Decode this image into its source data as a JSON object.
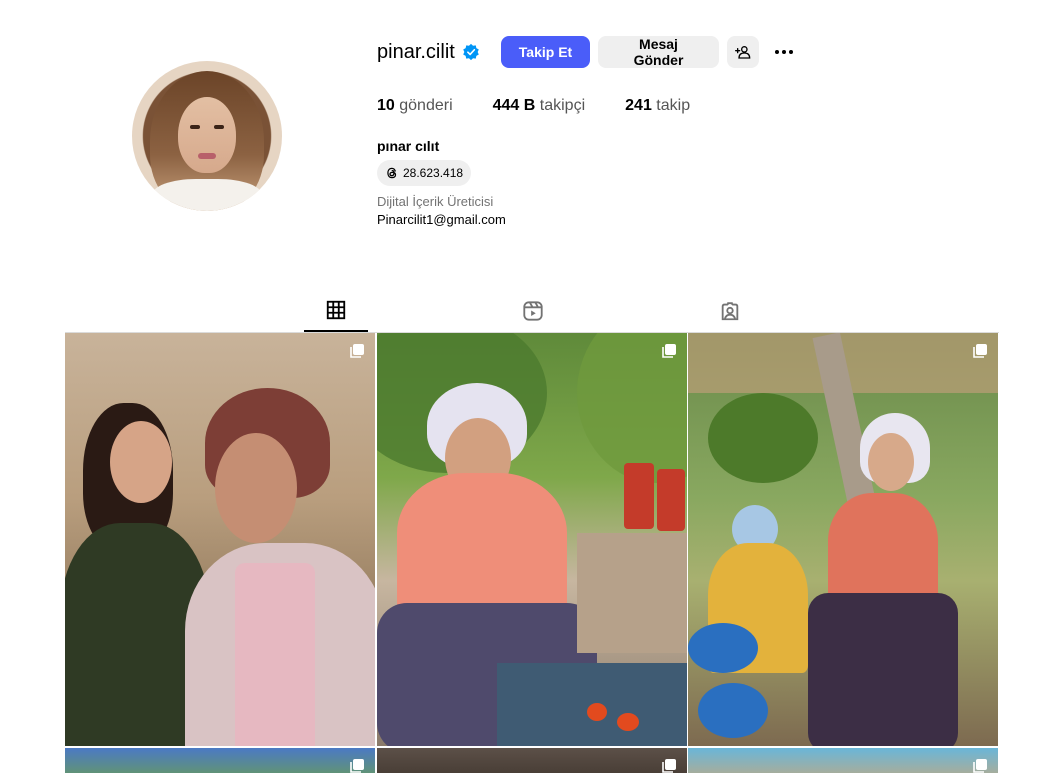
{
  "profile": {
    "username": "pinar.cilit",
    "verified": true,
    "follow_label": "Takip Et",
    "message_label": "Mesaj Gönder",
    "add_user_icon": "person-plus-icon",
    "more_icon": "more-horizontal-icon",
    "stats": {
      "posts_count": "10",
      "posts_label": "gönderi",
      "followers_count": "444 B",
      "followers_label": "takipçi",
      "following_count": "241",
      "following_label": "takip"
    },
    "full_name": "pınar cılıt",
    "threads_count": "28.623.418",
    "category": "Dijital İçerik Üreticisi",
    "email": "Pinarcilit1@gmail.com"
  },
  "tabs": [
    {
      "icon": "grid-icon",
      "active": true
    },
    {
      "icon": "reels-icon",
      "active": false
    },
    {
      "icon": "tagged-icon",
      "active": false
    }
  ],
  "posts": [
    {
      "icon": "multiple-images-icon"
    },
    {
      "icon": "multiple-images-icon"
    },
    {
      "icon": "multiple-images-icon"
    },
    {
      "icon": "multiple-images-icon"
    },
    {
      "icon": "multiple-images-icon"
    },
    {
      "icon": "multiple-images-icon"
    }
  ],
  "colors": {
    "follow_button": "#4a5df9",
    "secondary_button": "#efefef",
    "verified_badge": "#0095f6",
    "muted_text": "#737373"
  }
}
